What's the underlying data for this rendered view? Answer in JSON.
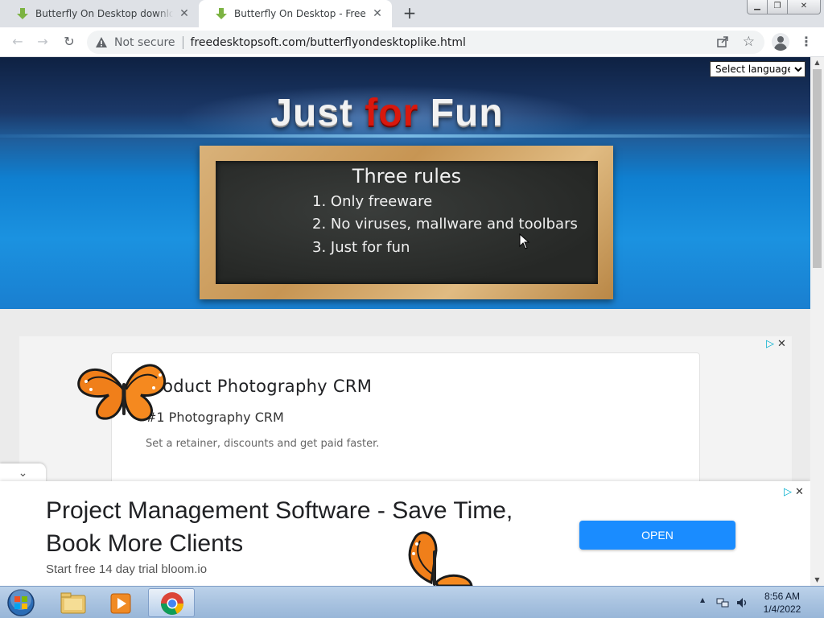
{
  "browser": {
    "tabs": [
      {
        "title": "Butterfly On Desktop download free",
        "active": false
      },
      {
        "title": "Butterfly On Desktop - Freeware",
        "active": true
      }
    ],
    "new_tab_label": "+",
    "omnibox": {
      "security": "Not secure",
      "url": "freedesktopsoft.com/butterflyondesktoplike.html"
    }
  },
  "page": {
    "language_select": {
      "selected": "Select language"
    },
    "hero_title": {
      "w1": "Just",
      "w2": "for",
      "w3": "Fun"
    },
    "chalkboard": {
      "heading": "Three rules",
      "rules": [
        "1. Only freeware",
        "2. No viruses, mallware and toolbars",
        "3. Just for fun"
      ]
    },
    "ad_card": {
      "headline": "Product Photography CRM",
      "subheadline": "#1 Photography CRM",
      "description": "Set a retainer, discounts and get paid faster."
    },
    "bottom_ad": {
      "headline": "Project Management Software - Save Time, Book More Clients",
      "sub": "Start free 14 day trial bloom.io",
      "button": "OPEN"
    }
  },
  "taskbar": {
    "items": [
      "start-orb",
      "file-explorer",
      "media-player",
      "chrome"
    ],
    "clock": {
      "time": "8:56 AM",
      "date": "1/4/2022"
    }
  },
  "colors": {
    "hero_red": "#d9180d",
    "open_button": "#1a8cff",
    "adchoices": "#00aecd"
  }
}
